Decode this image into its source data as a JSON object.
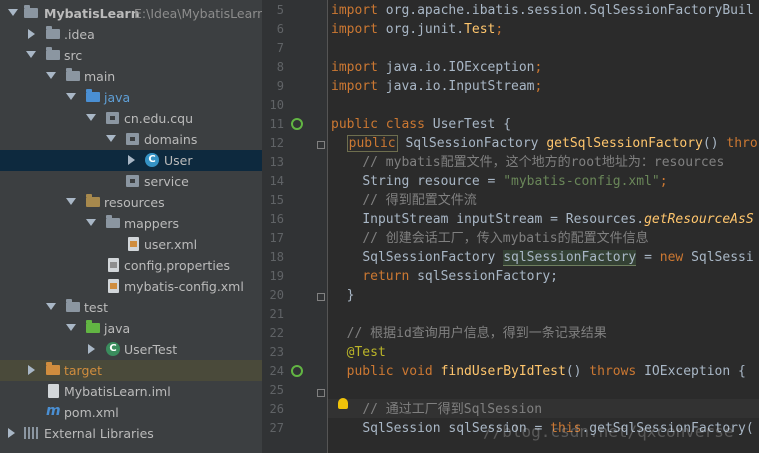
{
  "project_tree": {
    "project_name": "MybatisLearn",
    "project_path": "E:\\Idea\\MybatisLearn",
    "items": {
      "idea": ".idea",
      "src": "src",
      "main": "main",
      "java_main": "java",
      "package": "cn.edu.cqu",
      "domains": "domains",
      "user_class": "User",
      "service": "service",
      "resources": "resources",
      "mappers": "mappers",
      "user_xml": "user.xml",
      "config_properties": "config.properties",
      "mybatis_config": "mybatis-config.xml",
      "test": "test",
      "java_test": "java",
      "user_test": "UserTest",
      "target": "target",
      "iml": "MybatisLearn.iml",
      "pom": "pom.xml",
      "external_libraries": "External Libraries"
    }
  },
  "gutter": {
    "line_numbers": [
      "5",
      "6",
      "7",
      "8",
      "9",
      "10",
      "11",
      "12",
      "13",
      "14",
      "15",
      "16",
      "17",
      "18",
      "19",
      "20",
      "21",
      "22",
      "23",
      "24",
      "25",
      "26",
      "27"
    ]
  },
  "code": {
    "l5a": "import ",
    "l5b": "org.apache.ibatis.session.SqlSessionFactoryBuil",
    "l6a": "import ",
    "l6b": "org.junit.",
    "l6c": "Test",
    "l6d": ";",
    "l8a": "import ",
    "l8b": "java.io.IOException",
    "l8c": ";",
    "l9a": "import ",
    "l9b": "java.io.InputStream",
    "l9c": ";",
    "l11a": "public class ",
    "l11b": "UserTest {",
    "l12a": "public",
    "l12b": " SqlSessionFactory ",
    "l12c": "getSqlSessionFactory",
    "l12d": "() ",
    "l12e": "thro",
    "l13": "// mybatis配置文件，这个地方的root地址为：resources",
    "l14a": "String resource = ",
    "l14b": "\"mybatis-config.xml\"",
    "l14c": ";",
    "l15": "// 得到配置文件流",
    "l16a": "InputStream inputStream = Resources.",
    "l16b": "getResourceAsS",
    "l17": "// 创建会话工厂，传入mybatis的配置文件信息",
    "l18a": "SqlSessionFactory ",
    "l18b": "sqlSessionFactory",
    "l18c": " = ",
    "l18d": "new ",
    "l18e": "SqlSessi",
    "l19a": "return ",
    "l19b": "sqlSessionFactory;",
    "l20": "}",
    "l22": "// 根据id查询用户信息，得到一条记录结果",
    "l23": "@Test",
    "l24a": "public void ",
    "l24b": "findUserByIdTest",
    "l24c": "() ",
    "l24d": "throws ",
    "l24e": "IOException {",
    "l26": "// 通过工厂得到SqlSession",
    "l27a": "SqlSession sqlSession = ",
    "l27b": "this",
    "l27c": ".getSqlSessionFactory("
  },
  "watermark": "//blog.csdn.net/qxconverse",
  "colors": {
    "tree_bg": "#3c3f41",
    "editor_bg": "#2b2b2b",
    "gutter_bg": "#313335",
    "keyword": "#cc7832",
    "string": "#6a8759",
    "comment": "#808080",
    "method": "#ffc66d",
    "annotation": "#bbb529"
  }
}
